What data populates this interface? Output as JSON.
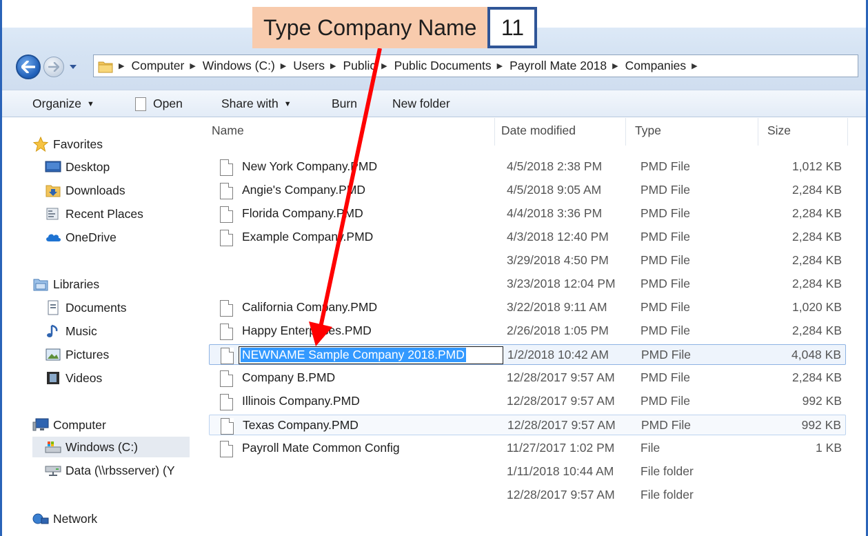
{
  "callout": {
    "label": "Type Company Name",
    "step": "11"
  },
  "breadcrumb": [
    "Computer",
    "Windows (C:)",
    "Users",
    "Public",
    "Public Documents",
    "Payroll Mate 2018",
    "Companies"
  ],
  "toolbar": {
    "organize": "Organize",
    "open": "Open",
    "share_with": "Share with",
    "burn": "Burn",
    "new_folder": "New folder"
  },
  "nav": {
    "favorites": "Favorites",
    "desktop": "Desktop",
    "downloads": "Downloads",
    "recent_places": "Recent Places",
    "onedrive": "OneDrive",
    "libraries": "Libraries",
    "documents": "Documents",
    "music": "Music",
    "pictures": "Pictures",
    "videos": "Videos",
    "computer": "Computer",
    "windows_c": "Windows (C:)",
    "data_drive": "Data (\\\\rbsserver) (Y",
    "network": "Network"
  },
  "columns": {
    "name": "Name",
    "date": "Date modified",
    "type": "Type",
    "size": "Size"
  },
  "files": [
    {
      "name": "New York Company.PMD",
      "date": "4/5/2018 2:38 PM",
      "type": "PMD File",
      "size": "1,012 KB"
    },
    {
      "name": "Angie's Company.PMD",
      "date": "4/5/2018 9:05 AM",
      "type": "PMD File",
      "size": "2,284 KB"
    },
    {
      "name": "Florida Company.PMD",
      "date": "4/4/2018 3:36 PM",
      "type": "PMD File",
      "size": "2,284 KB"
    },
    {
      "name": "Example Company.PMD",
      "date": "4/3/2018 12:40 PM",
      "type": "PMD File",
      "size": "2,284 KB"
    },
    {
      "name": "",
      "date": "3/29/2018 4:50 PM",
      "type": "PMD File",
      "size": "2,284 KB"
    },
    {
      "name": "",
      "date": "3/23/2018 12:04 PM",
      "type": "PMD File",
      "size": "2,284 KB"
    },
    {
      "name": "California Company.PMD",
      "date": "3/22/2018 9:11 AM",
      "type": "PMD File",
      "size": "1,020 KB"
    },
    {
      "name": "Happy Enterprises.PMD",
      "date": "2/26/2018 1:05 PM",
      "type": "PMD File",
      "size": "2,284 KB"
    },
    {
      "name": "NEWNAME Sample Company 2018.PMD",
      "date": "1/2/2018 10:42 AM",
      "type": "PMD File",
      "size": "4,048 KB"
    },
    {
      "name": "Company B.PMD",
      "date": "12/28/2017 9:57 AM",
      "type": "PMD File",
      "size": "2,284 KB"
    },
    {
      "name": "Illinois Company.PMD",
      "date": "12/28/2017 9:57 AM",
      "type": "PMD File",
      "size": "992 KB"
    },
    {
      "name": "Texas Company.PMD",
      "date": "12/28/2017 9:57 AM",
      "type": "PMD File",
      "size": "992 KB"
    },
    {
      "name": "Payroll Mate Common Config",
      "date": "11/27/2017 1:02 PM",
      "type": "File",
      "size": "1 KB"
    },
    {
      "name": "",
      "date": "1/11/2018 10:44 AM",
      "type": "File folder",
      "size": ""
    },
    {
      "name": "",
      "date": "12/28/2017 9:57 AM",
      "type": "File folder",
      "size": ""
    }
  ],
  "colors": {
    "callout_bg": "#f8cbad",
    "callout_border": "#2f5597",
    "arrow": "#ff0000",
    "selection": "#3399ff",
    "window_border": "#2a63b8"
  }
}
